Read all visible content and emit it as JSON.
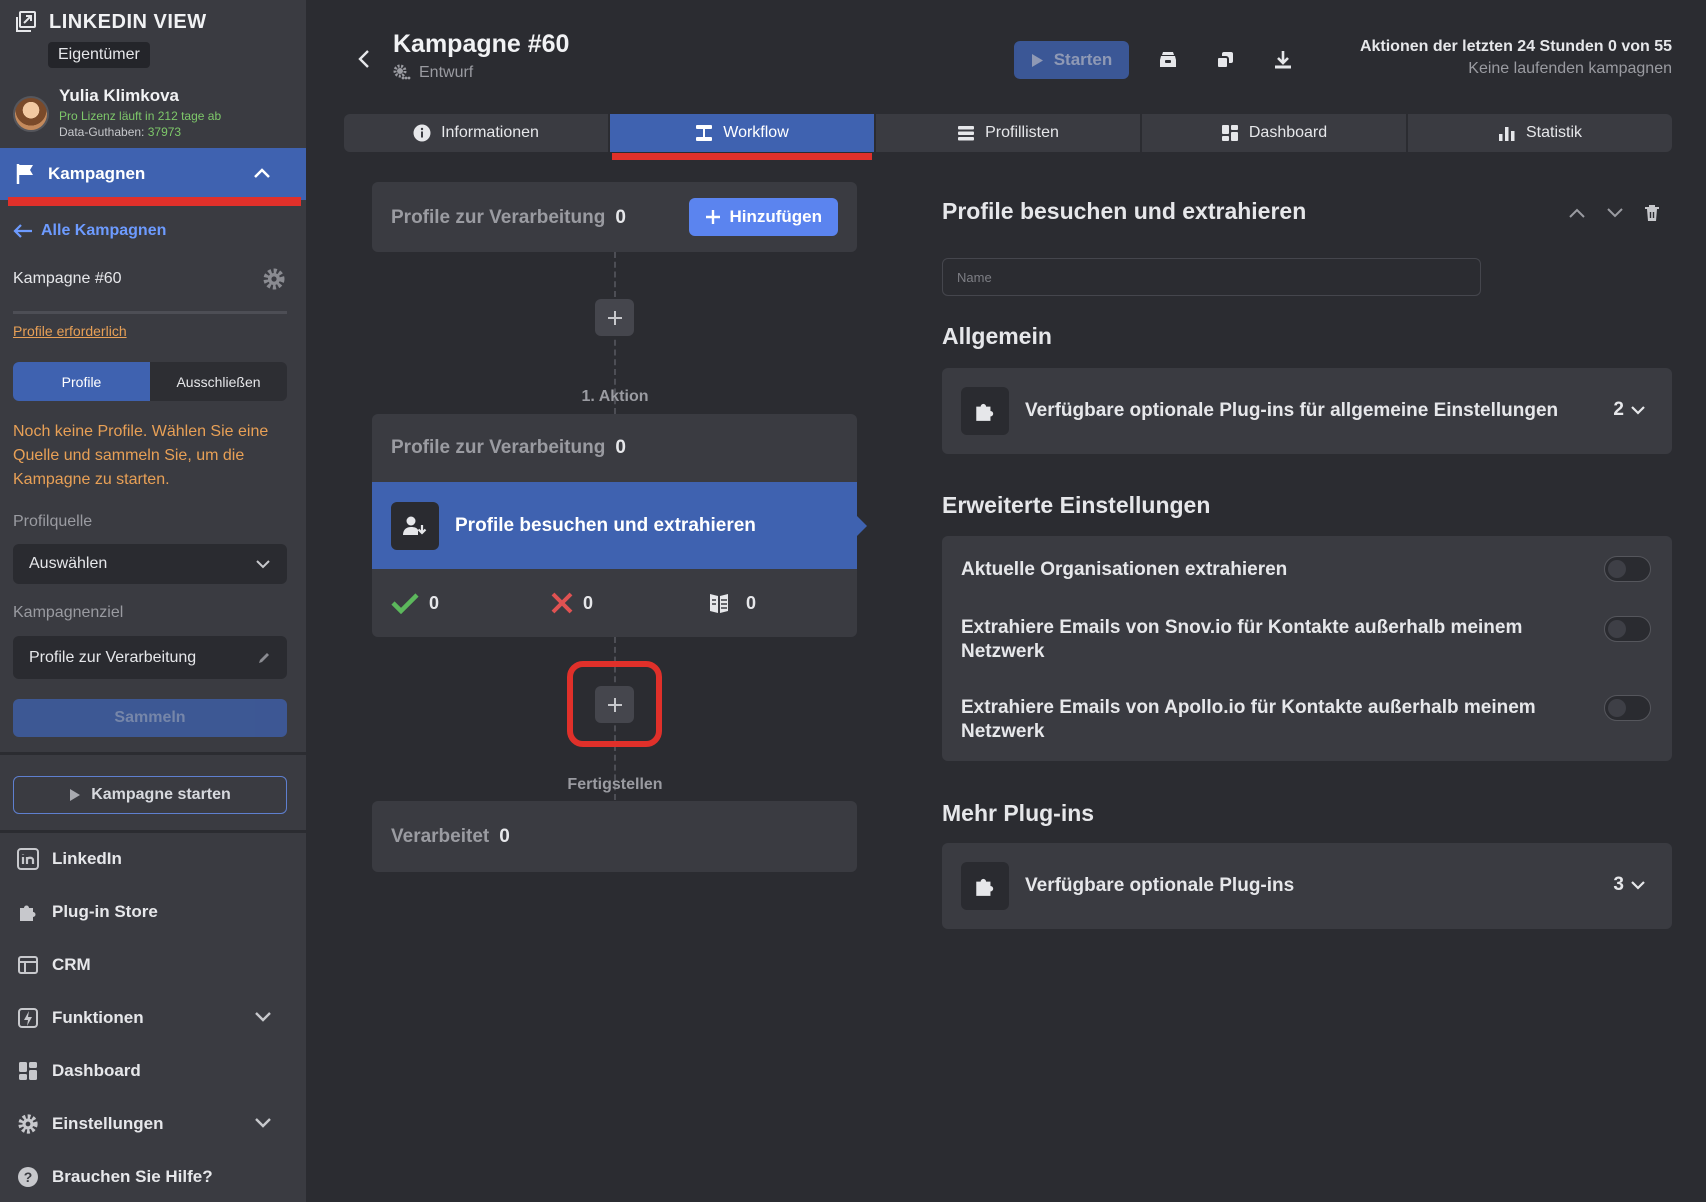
{
  "app": {
    "title": "LINKEDIN VIEW",
    "owner_badge": "Eigentümer"
  },
  "user": {
    "name": "Yulia Klimkova",
    "license": "Pro Lizenz läuft in 212 tage ab",
    "credit_label": "Data-Guthaben:",
    "credit_value": "37973"
  },
  "sidebar": {
    "active_section": "Kampagnen",
    "back_link": "Alle Kampagnen",
    "campaign_name": "Kampagne #60",
    "required_link": "Profile erforderlich",
    "segments": [
      "Profile",
      "Ausschließen"
    ],
    "active_segment": "Profile",
    "no_profiles_text": "Noch keine Profile. Wählen Sie eine Quelle und sammeln Sie, um die Kampagne zu starten.",
    "source_label": "Profilquelle",
    "source_value": "Auswählen",
    "goal_label": "Kampagnenziel",
    "goal_value": "Profile zur Verarbeitung",
    "collect_button": "Sammeln",
    "start_campaign_button": "Kampagne starten",
    "menu": [
      {
        "label": "LinkedIn",
        "icon": "linkedin-icon"
      },
      {
        "label": "Plug-in Store",
        "icon": "puzzle-icon"
      },
      {
        "label": "CRM",
        "icon": "crm-icon"
      },
      {
        "label": "Funktionen",
        "icon": "bolt-icon",
        "expandable": true
      },
      {
        "label": "Dashboard",
        "icon": "dashboard-icon"
      },
      {
        "label": "Einstellungen",
        "icon": "gear-icon",
        "expandable": true
      },
      {
        "label": "Brauchen Sie Hilfe?",
        "icon": "help-icon"
      }
    ]
  },
  "header": {
    "title": "Kampagne #60",
    "status": "Entwurf",
    "start_button": "Starten",
    "actions_line": "Aktionen der letzten 24 Stunden 0 von 55",
    "running_line": "Keine laufenden kampagnen"
  },
  "tabs": [
    {
      "label": "Informationen",
      "icon": "info-icon"
    },
    {
      "label": "Workflow",
      "icon": "workflow-icon",
      "active": true
    },
    {
      "label": "Profillisten",
      "icon": "list-icon"
    },
    {
      "label": "Dashboard",
      "icon": "dashboard-icon"
    },
    {
      "label": "Statistik",
      "icon": "bar-chart-icon"
    }
  ],
  "workflow": {
    "source_card": {
      "label": "Profile zur Verarbeitung",
      "count": "0",
      "add_button": "Hinzufügen"
    },
    "step_label": "1. Aktion",
    "action_card": {
      "label": "Profile zur Verarbeitung",
      "count": "0",
      "action_title": "Profile besuchen und extrahieren",
      "success_count": "0",
      "fail_count": "0",
      "skipped_count": "0"
    },
    "finish_label": "Fertigstellen",
    "done_card": {
      "label": "Verarbeitet",
      "count": "0"
    }
  },
  "panel": {
    "title": "Profile besuchen und extrahieren",
    "name_placeholder": "Name",
    "general_title": "Allgemein",
    "general_plugins": {
      "label": "Verfügbare optionale Plug-ins für allgemeine Einstellungen",
      "count": "2"
    },
    "advanced_title": "Erweiterte Einstellungen",
    "options": [
      {
        "label": "Aktuelle Organisationen extrahieren",
        "enabled": false
      },
      {
        "label": "Extrahiere Emails von Snov.io für Kontakte außerhalb meinem Netzwerk",
        "enabled": false
      },
      {
        "label": "Extrahiere Emails von Apollo.io für Kontakte außerhalb meinem Netzwerk",
        "enabled": false
      }
    ],
    "more_title": "Mehr Plug-ins",
    "more_plugins": {
      "label": "Verfügbare optionale Plug-ins",
      "count": "3"
    }
  },
  "colors": {
    "accent": "#3f62b0",
    "accent_bright": "#5b84ef",
    "highlight_red": "#e0302a",
    "warning_orange": "#e8a056",
    "success_green": "#7ec86a",
    "error_red": "#e05252",
    "sidebar_bg": "#3a3b41",
    "page_bg": "#2b2c31"
  }
}
